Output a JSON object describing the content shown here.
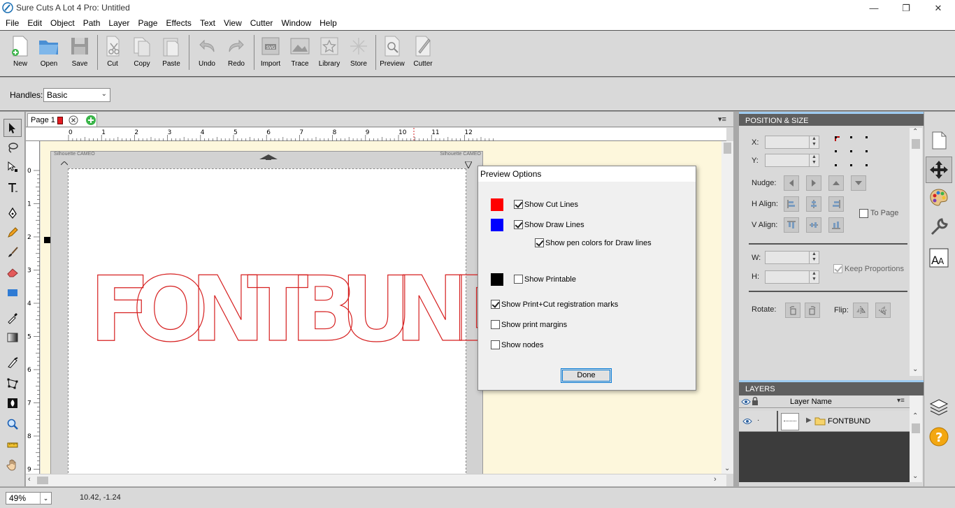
{
  "window": {
    "title": "Sure Cuts A Lot 4 Pro: Untitled",
    "minimize": "—",
    "restore": "❐",
    "close": "✕"
  },
  "menu": [
    "File",
    "Edit",
    "Object",
    "Path",
    "Layer",
    "Page",
    "Effects",
    "Text",
    "View",
    "Cutter",
    "Window",
    "Help"
  ],
  "toolbar": {
    "new": "New",
    "open": "Open",
    "save": "Save",
    "cut": "Cut",
    "copy": "Copy",
    "paste": "Paste",
    "undo": "Undo",
    "redo": "Redo",
    "import": "Import",
    "trace": "Trace",
    "library": "Library",
    "store": "Store",
    "preview": "Preview",
    "cutter": "Cutter"
  },
  "handles": {
    "label": "Handles:",
    "value": "Basic"
  },
  "page_tab": {
    "label": "Page 1",
    "color": "#e51c23"
  },
  "ruler": {
    "top": [
      "0",
      "1",
      "2",
      "3",
      "4",
      "5",
      "6",
      "7",
      "8",
      "9",
      "10",
      "11",
      "12"
    ],
    "left": [
      "0",
      "1",
      "2",
      "3",
      "4",
      "5",
      "6",
      "7",
      "8",
      "9"
    ]
  },
  "mat": {
    "label_left": "Silhouette CAMEO",
    "label_right": "Silhouette CAMEO"
  },
  "canvas_text": "FONTBUND",
  "position_size": {
    "title": "POSITION & SIZE",
    "x_label": "X:",
    "y_label": "Y:",
    "nudge_label": "Nudge:",
    "halign_label": "H Align:",
    "valign_label": "V Align:",
    "to_page": "To Page",
    "w_label": "W:",
    "h_label": "H:",
    "keep_proportions": "Keep Proportions",
    "rotate_label": "Rotate:",
    "flip_label": "Flip:"
  },
  "layers": {
    "title": "LAYERS",
    "col_name": "Layer Name",
    "rows": [
      {
        "name": "FONTBUND",
        "visible": true
      }
    ]
  },
  "preview_options": {
    "title": "Preview Options",
    "show_cut_lines": {
      "label": "Show Cut Lines",
      "checked": true,
      "color": "#ff0000"
    },
    "show_draw_lines": {
      "label": "Show Draw Lines",
      "checked": true,
      "color": "#0000ff"
    },
    "show_pen_colors": {
      "label": "Show pen colors for Draw lines",
      "checked": true
    },
    "show_printable": {
      "label": "Show Printable",
      "checked": false,
      "color": "#000000"
    },
    "show_registration": {
      "label": "Show Print+Cut registration marks",
      "checked": true
    },
    "show_print_margins": {
      "label": "Show print margins",
      "checked": false
    },
    "show_nodes": {
      "label": "Show nodes",
      "checked": false
    },
    "done": "Done"
  },
  "status": {
    "zoom": "49%",
    "coords": "10.42, -1.24"
  }
}
